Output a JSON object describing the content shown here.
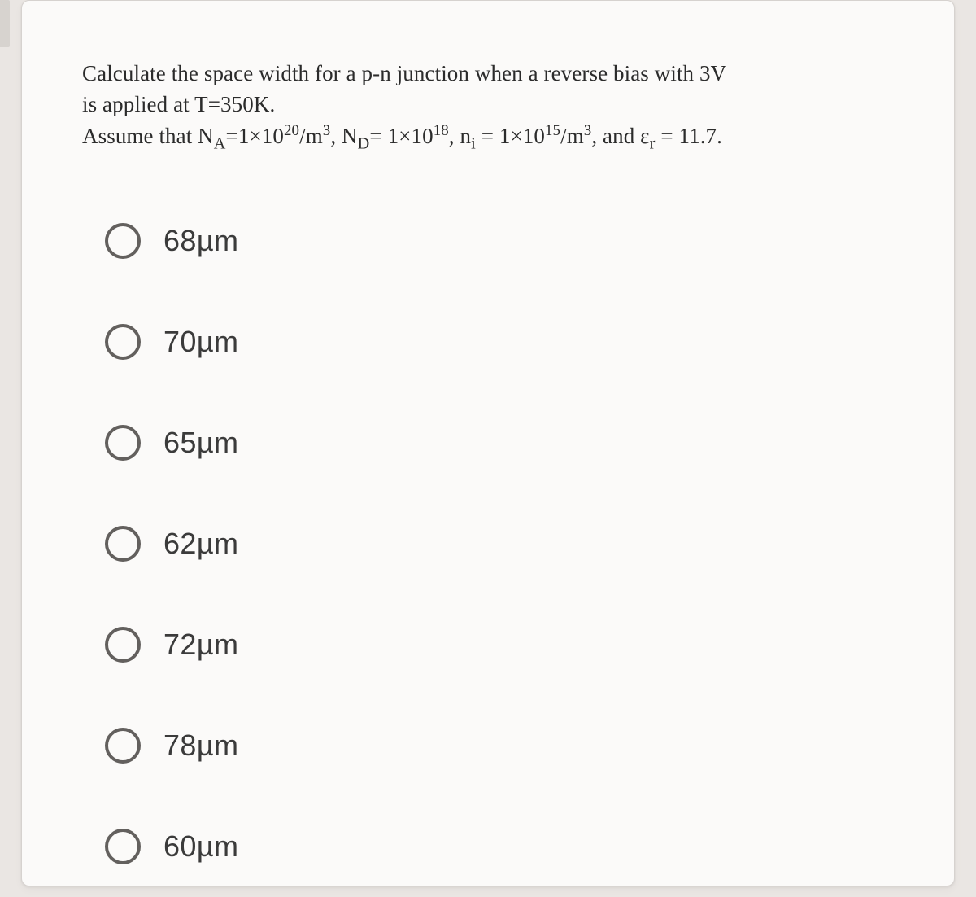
{
  "question": {
    "line1_pre": "Calculate the space width for a p-n junction when a reverse bias with 3V",
    "line2_pre": "is applied at T=350K.",
    "assume_prefix": "Assume that N",
    "NA_sub": "A",
    "eq1": "=1×10",
    "NA_exp": "20",
    "per_m3_a": "/m",
    "cubed": "3",
    "sep1": ", N",
    "ND_sub": "D",
    "eq2": "= 1×10",
    "ND_exp": "18",
    "sep2": ", n",
    "ni_sub": "i",
    "eq3": " = 1×10",
    "ni_exp": "15",
    "per_m3_b": "/m",
    "sep3": ", and ε",
    "er_sub": "r",
    "eq4": " = 11.7."
  },
  "options": [
    {
      "label": "68µm"
    },
    {
      "label": "70µm"
    },
    {
      "label": "65µm"
    },
    {
      "label": "62µm"
    },
    {
      "label": "72µm"
    },
    {
      "label": "78µm"
    },
    {
      "label": "60µm"
    }
  ]
}
